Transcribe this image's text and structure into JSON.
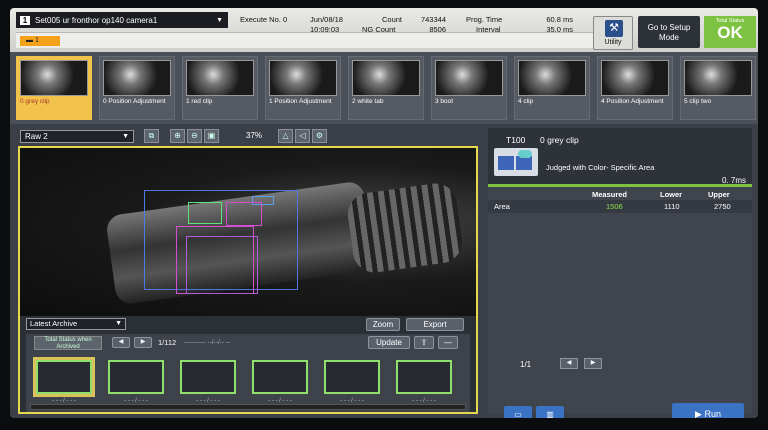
{
  "header": {
    "set_number": "1",
    "set_name": "Set005 ur fronthor op140 camera1",
    "tag_label": "1",
    "execute_label": "Execute No. 0",
    "date": "Jun/08/18",
    "time": "10:09:03",
    "count_label": "Count",
    "count_value": "743344",
    "ng_count_label": "NG Count",
    "ng_count_value": "8506",
    "prog_time_label": "Prog. Time",
    "prog_time_value": "60.8 ms",
    "interval_label": "Interval",
    "interval_value": "35.0 ms",
    "utility_label": "Utility",
    "setup_mode_label": "Go to Setup Mode",
    "total_status_label": "Total Status",
    "total_status_value": "OK",
    "status_color": "#7ec242"
  },
  "tools": [
    {
      "caption": "0 grey clip",
      "selected": true
    },
    {
      "caption": "0 Position Adjustment",
      "selected": false
    },
    {
      "caption": "1 red clip",
      "selected": false
    },
    {
      "caption": "1 Position Adjustment",
      "selected": false
    },
    {
      "caption": "2 white tab",
      "selected": false
    },
    {
      "caption": "3 boot",
      "selected": false
    },
    {
      "caption": "4 clip",
      "selected": false
    },
    {
      "caption": "4 Position Adjustment",
      "selected": false
    },
    {
      "caption": "5 clip two",
      "selected": false
    }
  ],
  "viewer": {
    "image_select": "Raw 2",
    "zoom_level": "37%",
    "archive_select": "Latest Archive",
    "zoom_button": "Zoom",
    "export_button": "Export",
    "update_button": "Update",
    "page_counter": "1/112",
    "page_dots": "---------- --/--/-- --",
    "total_status_archived": "Total Status when Archived",
    "frame_dots": "- - - / - - -",
    "frames": 6,
    "highlight_color": "#e6d84a"
  },
  "result": {
    "tool_id": "T100",
    "tool_name": "0 grey clip",
    "judgement": "Judged with Color- Specific Area",
    "time": "0. 7ms",
    "headers": {
      "measured": "Measured",
      "lower": "Lower",
      "upper": "Upper"
    },
    "row": {
      "item": "Area",
      "measured": "1506",
      "lower": "1110",
      "upper": "2750"
    },
    "page": "1/1",
    "run_button": "Run"
  }
}
